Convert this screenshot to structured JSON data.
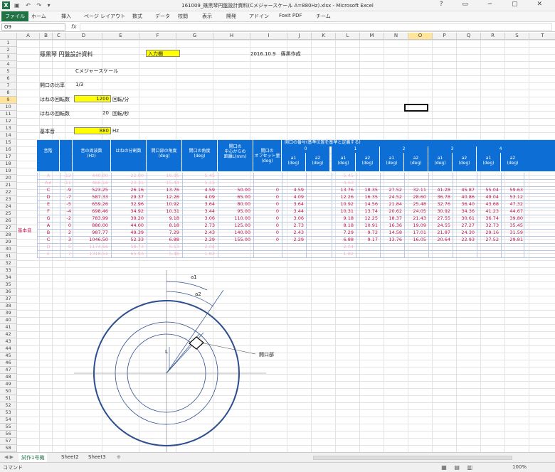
{
  "window": {
    "title": "161009_篠黒琴円盤設計資料(Cメジャースケール A=880Hz).xlsx - Microsoft Excel"
  },
  "ribbon": {
    "tabs": [
      "ファイル",
      "ホーム",
      "挿入",
      "ページ レイアウト",
      "数式",
      "データ",
      "校閲",
      "表示",
      "開発",
      "アドイン",
      "Foxit PDF",
      "チーム"
    ]
  },
  "formula": {
    "namebox": "O9",
    "fx": "fx"
  },
  "columns": [
    "A",
    "B",
    "C",
    "D",
    "E",
    "F",
    "G",
    "H",
    "I",
    "J",
    "K",
    "L",
    "M",
    "N",
    "O",
    "P",
    "Q",
    "R",
    "S",
    "T"
  ],
  "selected_column": "O",
  "selected_row": "9",
  "header_block": {
    "doc_title": "篠黒琴 円盤設計資料",
    "input_label": "入力欄",
    "date_author": "2016.10.9　篠黒作成",
    "scale": "Cメジャースケール",
    "ratio_label": "開口の比率",
    "ratio_value": "1/3",
    "rpm_label": "はねの回転数",
    "rpm_value": "1200",
    "rpm_unit": "回転/分",
    "rps_label": "はねの回転数",
    "rps_value": "20",
    "rps_unit": "回転/秒",
    "base_label": "基本音",
    "base_value": "880",
    "base_unit": "Hz"
  },
  "table": {
    "headers": [
      "音階",
      "",
      "音の周波数\n(Hz)",
      "はねの分割数",
      "開口部の角度\n(deg)",
      "開口の角度\n(deg)",
      "開口の\n中心からの\n距離L(mm)",
      "開口の\nオフセット量\n(deg)"
    ],
    "group_header": "開口の番号(基準位置を基準と定義する)",
    "group_numbers": [
      "0",
      "1",
      "2",
      "3",
      "4"
    ],
    "sub_headers": [
      "a1\n(deg)",
      "a2\n(deg)"
    ],
    "side_label": "基本音",
    "rows": [
      {
        "note": "A",
        "n": "-12",
        "freq": "440.00",
        "div": "22.00",
        "deg1": "16.36",
        "deg2": "5.45",
        "L": "",
        "off": "",
        "g": [
          "",
          "",
          "5.45",
          "",
          "",
          "",
          "",
          "",
          "",
          ""
        ],
        "fade": true
      },
      {
        "note": "A#",
        "n": "-11",
        "freq": "466.16",
        "div": "23.31",
        "deg1": "15.44",
        "deg2": "5.15",
        "L": "",
        "off": "",
        "g": [
          "",
          "",
          "4.63",
          "",
          "",
          "",
          "",
          "",
          "",
          ""
        ],
        "fade": true
      },
      {
        "note": "C",
        "n": "-9",
        "freq": "523.25",
        "div": "26.16",
        "deg1": "13.76",
        "deg2": "4.59",
        "L": "50.00",
        "off": "0",
        "g": [
          "4.59",
          "",
          "13.76",
          "18.35",
          "27.52",
          "32.11",
          "41.28",
          "45.87",
          "55.04",
          "59.63"
        ],
        "fade": false
      },
      {
        "note": "D",
        "n": "-7",
        "freq": "587.33",
        "div": "29.37",
        "deg1": "12.26",
        "deg2": "4.09",
        "L": "65.00",
        "off": "0",
        "g": [
          "4.09",
          "",
          "12.26",
          "16.35",
          "24.52",
          "28.60",
          "36.78",
          "40.86",
          "49.04",
          "53.12"
        ],
        "fade": false
      },
      {
        "note": "E",
        "n": "-5",
        "freq": "659.26",
        "div": "32.96",
        "deg1": "10.92",
        "deg2": "3.64",
        "L": "80.00",
        "off": "0",
        "g": [
          "3.64",
          "",
          "10.92",
          "14.56",
          "21.84",
          "25.48",
          "32.76",
          "36.40",
          "43.68",
          "47.32"
        ],
        "fade": false
      },
      {
        "note": "F",
        "n": "-4",
        "freq": "698.46",
        "div": "34.92",
        "deg1": "10.31",
        "deg2": "3.44",
        "L": "95.00",
        "off": "0",
        "g": [
          "3.44",
          "",
          "10.31",
          "13.74",
          "20.62",
          "24.05",
          "30.92",
          "34.36",
          "41.23",
          "44.67"
        ],
        "fade": false
      },
      {
        "note": "G",
        "n": "-2",
        "freq": "783.99",
        "div": "39.20",
        "deg1": "9.18",
        "deg2": "3.06",
        "L": "110.00",
        "off": "0",
        "g": [
          "3.06",
          "",
          "9.18",
          "12.25",
          "18.37",
          "21.43",
          "27.55",
          "30.61",
          "36.74",
          "39.80"
        ],
        "fade": false
      },
      {
        "note": "A",
        "n": "0",
        "freq": "880.00",
        "div": "44.00",
        "deg1": "8.18",
        "deg2": "2.73",
        "L": "125.00",
        "off": "0",
        "g": [
          "2.73",
          "",
          "8.18",
          "10.91",
          "16.36",
          "19.09",
          "24.55",
          "27.27",
          "32.73",
          "35.45"
        ],
        "fade": false
      },
      {
        "note": "B",
        "n": "2",
        "freq": "987.77",
        "div": "49.39",
        "deg1": "7.29",
        "deg2": "2.43",
        "L": "140.00",
        "off": "0",
        "g": [
          "2.43",
          "",
          "7.29",
          "9.72",
          "14.58",
          "17.01",
          "21.87",
          "24.30",
          "29.16",
          "31.59"
        ],
        "fade": false
      },
      {
        "note": "C",
        "n": "3",
        "freq": "1046.50",
        "div": "52.33",
        "deg1": "6.88",
        "deg2": "2.29",
        "L": "155.00",
        "off": "0",
        "g": [
          "2.29",
          "",
          "6.88",
          "9.17",
          "13.76",
          "16.05",
          "20.64",
          "22.93",
          "27.52",
          "29.81"
        ],
        "fade": false
      },
      {
        "note": "D",
        "n": "5",
        "freq": "1174.66",
        "div": "58.73",
        "deg1": "6.13",
        "deg2": "2.04",
        "L": "",
        "off": "",
        "g": [
          "",
          "",
          "2.04",
          "",
          "",
          "",
          "",
          "",
          "",
          ""
        ],
        "fade": true
      },
      {
        "note": "E",
        "n": "7",
        "freq": "1318.51",
        "div": "65.93",
        "deg1": "5.46",
        "deg2": "1.82",
        "L": "",
        "off": "",
        "g": [
          "",
          "",
          "1.82",
          "",
          "",
          "",
          "",
          "",
          "",
          ""
        ],
        "fade": true
      }
    ]
  },
  "diagram": {
    "a1": "a1",
    "a2": "a2",
    "L": "L",
    "opening": "開口部"
  },
  "sheets": [
    "試作1号機",
    "Sheet2",
    "Sheet3"
  ],
  "status": {
    "mode": "コマンド",
    "zoom": "100%"
  },
  "colors": {
    "header_blue": "#0d6fd6",
    "input_yellow": "#ffff00",
    "data_pink": "#c0144a",
    "excel_green": "#217346",
    "diagram_blue": "#2e4f8f"
  }
}
